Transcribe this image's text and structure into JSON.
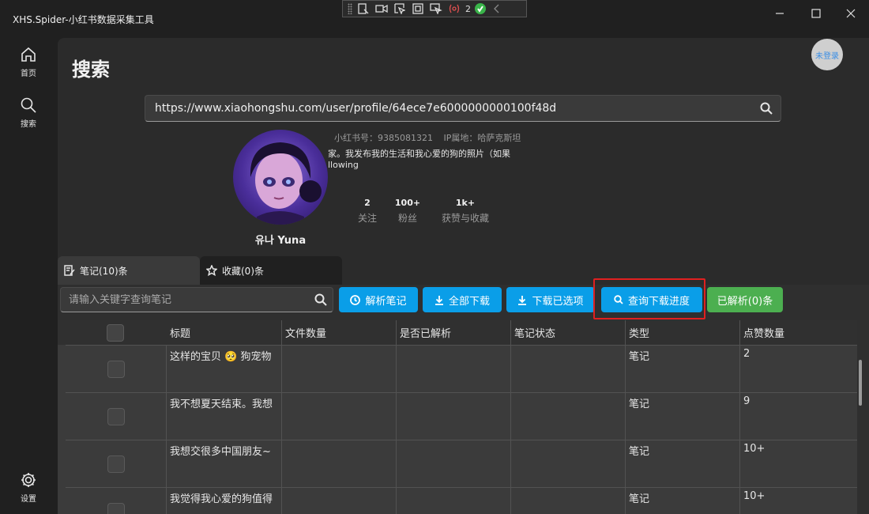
{
  "window": {
    "title": "XHS.Spider-小红书数据采集工具"
  },
  "devtools": {
    "error_count": "2"
  },
  "nav": {
    "home_label": "首页",
    "search_label": "搜索",
    "settings_label": "设置"
  },
  "page": {
    "title": "搜索",
    "login_status": "未登录"
  },
  "search": {
    "value": "https://www.xiaohongshu.com/user/profile/64ece7e6000000000100f48d"
  },
  "profile": {
    "red_id_label": "小红书号：9385081321",
    "ip_label": "IP属地：哈萨克斯坦",
    "bio_line1": "家。我发布我的生活和我心爱的狗的照片（如果",
    "bio_line2": "llowing",
    "nickname": "유나 Yuna",
    "stats": {
      "follow_count": "2",
      "follow_label": "关注",
      "fans_count": "100+",
      "fans_label": "粉丝",
      "likes_count": "1k+",
      "likes_label": "获赞与收藏"
    }
  },
  "tabs": {
    "notes": "笔记(10)条",
    "collects": "收藏(0)条"
  },
  "toolbar": {
    "keyword_placeholder": "请输入关键字查询笔记",
    "parse_notes": "解析笔记",
    "download_all": "全部下载",
    "download_selected": "下载已选项",
    "query_progress": "查询下载进度",
    "parsed_count": "已解析(0)条"
  },
  "table": {
    "columns": [
      "标题",
      "文件数量",
      "是否已解析",
      "笔记状态",
      "类型",
      "点赞数量"
    ],
    "rows": [
      {
        "title": "这样的宝贝 🥺 狗宠物",
        "files": "",
        "parsed": "",
        "status": "",
        "type": "笔记",
        "likes": "2"
      },
      {
        "title": "我不想夏天结束。我想",
        "files": "",
        "parsed": "",
        "status": "",
        "type": "笔记",
        "likes": "9"
      },
      {
        "title": "我想交很多中国朋友~",
        "files": "",
        "parsed": "",
        "status": "",
        "type": "笔记",
        "likes": "10+"
      },
      {
        "title": "我觉得我心爱的狗值得",
        "files": "",
        "parsed": "",
        "status": "",
        "type": "笔记",
        "likes": "10+"
      }
    ]
  },
  "colors": {
    "accent_blue": "#0a9ee8",
    "accent_green": "#4caf50",
    "highlight_red": "#e02020"
  }
}
